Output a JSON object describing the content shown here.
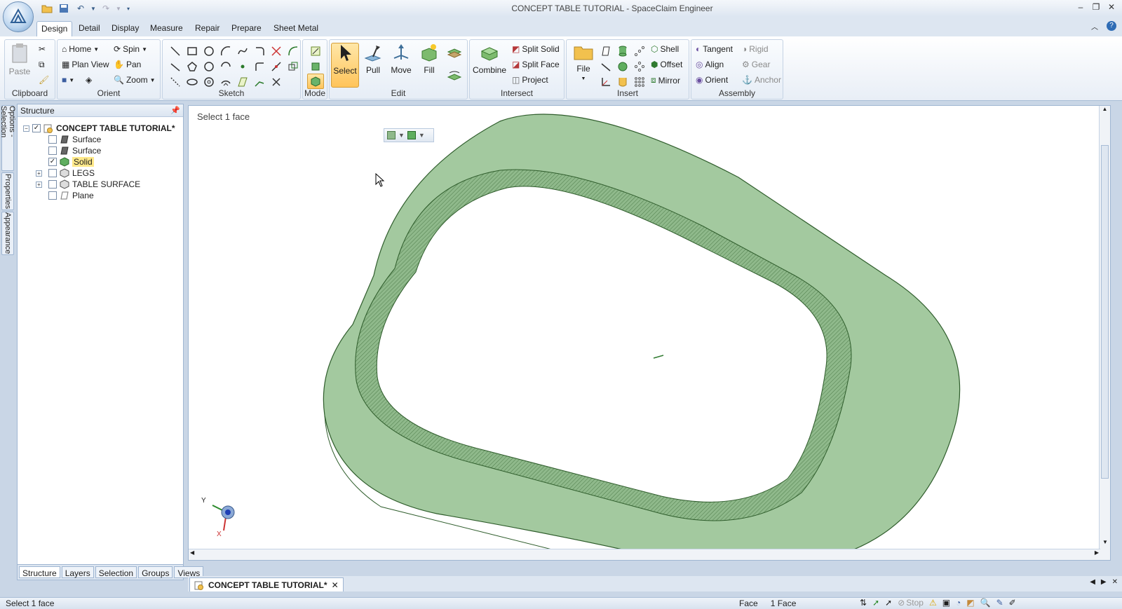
{
  "window": {
    "title": "CONCEPT TABLE TUTORIAL - SpaceClaim Engineer"
  },
  "tabs": [
    "Design",
    "Detail",
    "Display",
    "Measure",
    "Repair",
    "Prepare",
    "Sheet Metal"
  ],
  "ribbon": {
    "clipboard": {
      "label": "Clipboard",
      "paste": "Paste"
    },
    "orient": {
      "label": "Orient",
      "home": "Home",
      "spin": "Spin",
      "plan_view": "Plan View",
      "pan": "Pan",
      "zoom": "Zoom"
    },
    "sketch": {
      "label": "Sketch"
    },
    "mode": {
      "label": "Mode"
    },
    "edit": {
      "label": "Edit",
      "select": "Select",
      "pull": "Pull",
      "move": "Move",
      "fill": "Fill"
    },
    "intersect": {
      "label": "Intersect",
      "combine": "Combine",
      "split_solid": "Split Solid",
      "split_face": "Split Face",
      "project": "Project"
    },
    "insert": {
      "label": "Insert",
      "file": "File",
      "shell": "Shell",
      "offset": "Offset",
      "mirror": "Mirror"
    },
    "assembly": {
      "label": "Assembly",
      "tangent": "Tangent",
      "rigid": "Rigid",
      "align": "Align",
      "gear": "Gear",
      "orient": "Orient",
      "anchor": "Anchor"
    }
  },
  "side_tabs": [
    "Options - Selection",
    "Properties",
    "Appearance"
  ],
  "structure": {
    "title": "Structure",
    "root": "CONCEPT TABLE TUTORIAL*",
    "items": [
      "Surface",
      "Surface",
      "Solid",
      "LEGS",
      "TABLE SURFACE",
      "Plane"
    ],
    "bottom_tabs": [
      "Structure",
      "Layers",
      "Selection",
      "Groups",
      "Views"
    ]
  },
  "viewport": {
    "hint": "Select 1 face",
    "axis_y": "Y",
    "axis_x": "X",
    "face_color": "#a3c99f",
    "edge_color": "#2f5d2c"
  },
  "document_tab": "CONCEPT TABLE TUTORIAL*",
  "status": {
    "left": "Select 1 face",
    "mode": "Face",
    "count": "1 Face",
    "stop": "Stop"
  }
}
